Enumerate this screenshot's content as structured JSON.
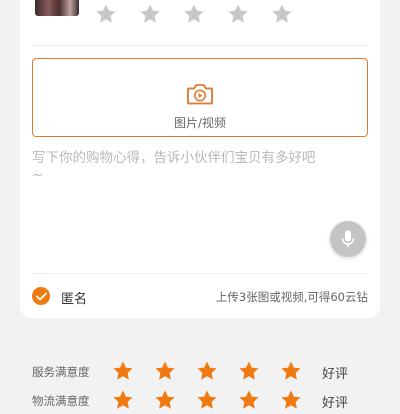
{
  "product": {
    "thumbnail_icon": "product-thumbnail",
    "rating_stars": 5,
    "rating_value": 0
  },
  "upload": {
    "icon": "camera-play-icon",
    "label": "图片/视频"
  },
  "review": {
    "placeholder": "写下你的购物心得，告诉小伙伴们宝贝有多好吧~",
    "mic_icon": "microphone-icon"
  },
  "anonymous": {
    "checked": true,
    "label": "匿名"
  },
  "reward_hint": "上传3张图或视频,可得60云钻",
  "ratings": [
    {
      "label": "服务满意度",
      "value": 5,
      "verdict": "好评"
    },
    {
      "label": "物流满意度",
      "value": 5,
      "verdict": "好评"
    }
  ],
  "colors": {
    "accent": "#f07a12",
    "star_empty": "#c8c8c8",
    "upload_border": "#e07a2e"
  }
}
